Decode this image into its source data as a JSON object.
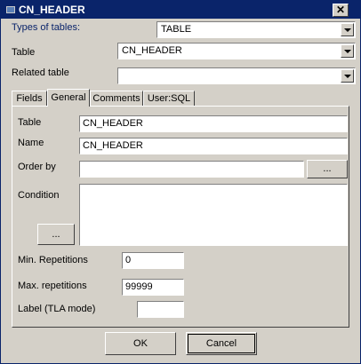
{
  "window": {
    "title": "CN_HEADER",
    "close_label": "✕"
  },
  "top": {
    "types_label": "Types of tables:",
    "types_value": "TABLE",
    "table_label": "Table",
    "table_value": "CN_HEADER",
    "related_label": "Related table",
    "related_value": ""
  },
  "tabs": [
    "Fields",
    "General",
    "Comments",
    "User:SQL"
  ],
  "active_tab": "General",
  "general": {
    "table_label": "Table",
    "table_value": "CN_HEADER",
    "name_label": "Name",
    "name_value": "CN_HEADER",
    "orderby_label": "Order by",
    "orderby_value": "",
    "orderby_button": "...",
    "condition_label": "Condition",
    "condition_value": "",
    "condition_button": "...",
    "min_label": "Min. Repetitions",
    "min_value": "0",
    "max_label": "Max. repetitions",
    "max_value": "99999",
    "tla_label": "Label (TLA mode)",
    "tla_value": ""
  },
  "buttons": {
    "ok": "OK",
    "cancel": "Cancel"
  }
}
